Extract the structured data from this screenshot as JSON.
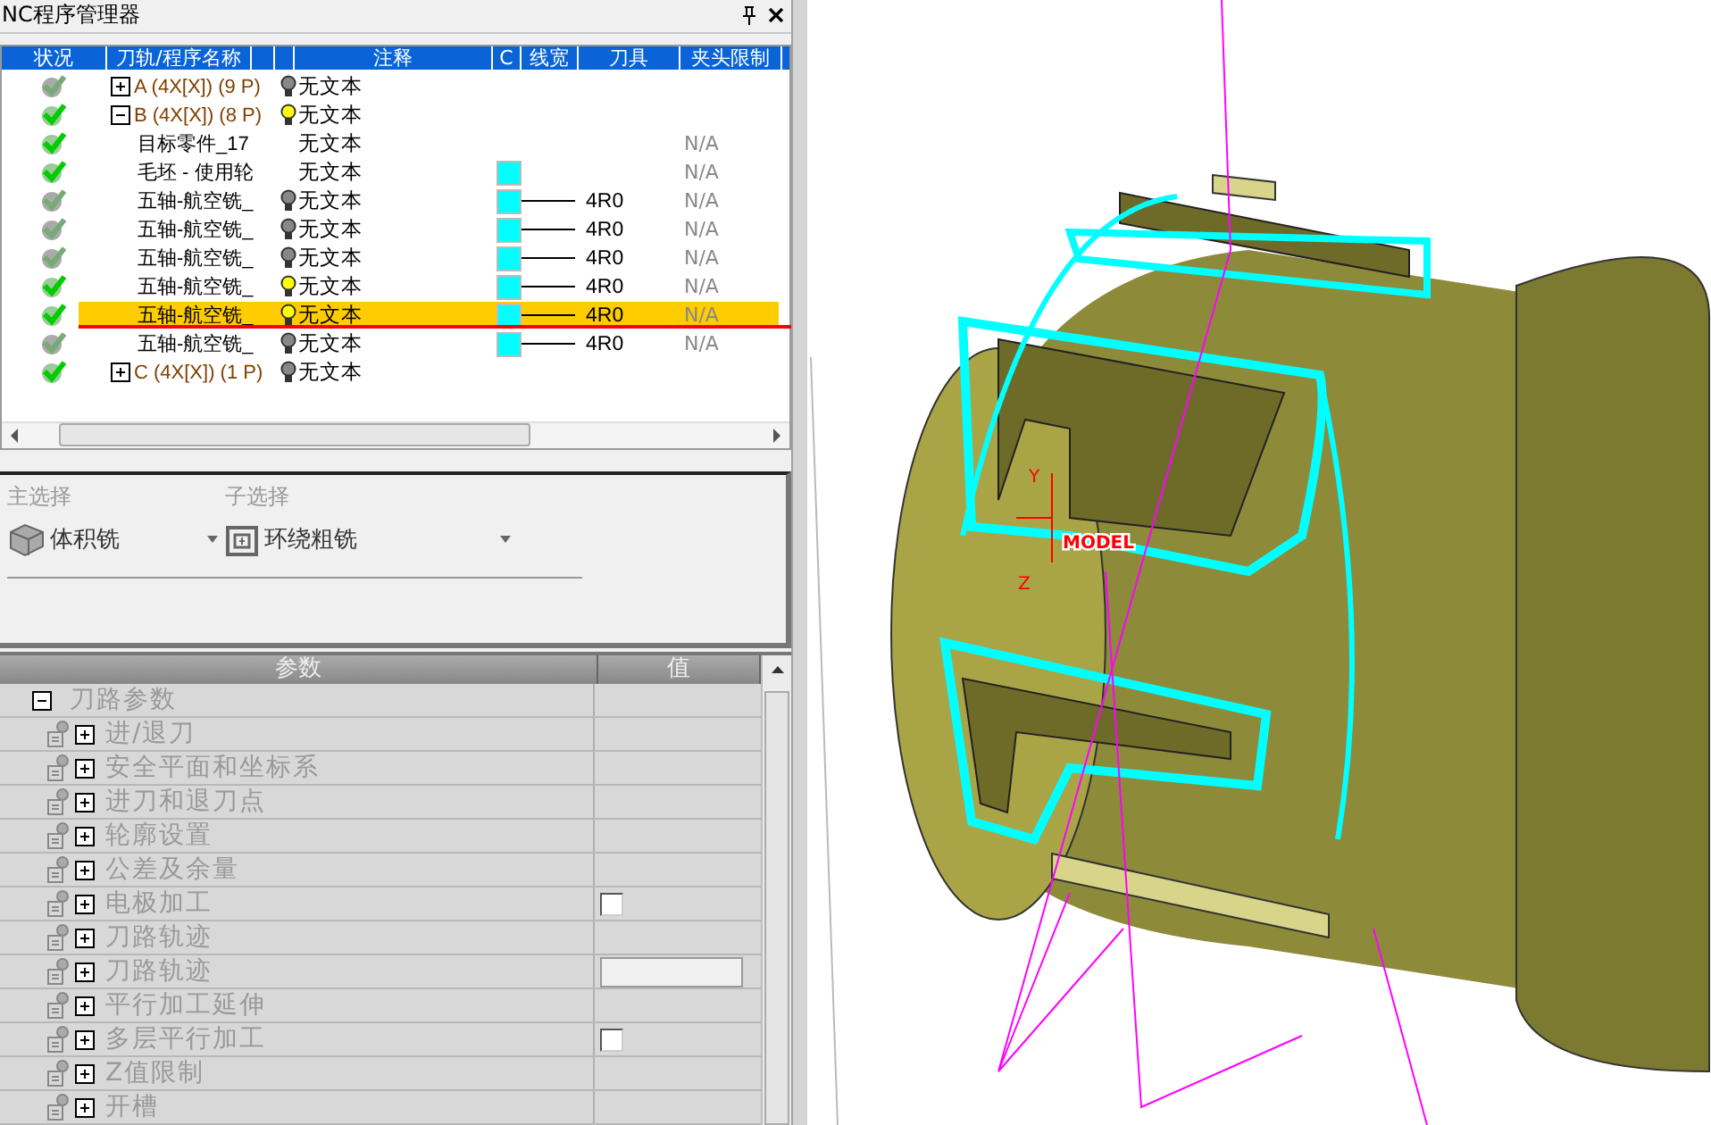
{
  "panel": {
    "title": "NC程序管理器"
  },
  "tree": {
    "columns": [
      "状况",
      "刀轨/程序名称",
      "",
      "",
      "注释",
      "C",
      "线宽",
      "刀具",
      "夹头限制"
    ],
    "rows": [
      {
        "complete": false,
        "expanded": false,
        "name": "A (4X[X]) (9 P)",
        "kind": "program",
        "lit": false,
        "note": "无文本",
        "selected": false
      },
      {
        "complete": true,
        "expanded": true,
        "name": "B (4X[X]) (8 P)",
        "kind": "program",
        "lit": true,
        "note": "无文本",
        "selected": false
      },
      {
        "complete": true,
        "name": "目标零件_17",
        "kind": "item",
        "note": "无文本",
        "clamp": "N/A",
        "selected": false
      },
      {
        "complete": true,
        "name": "毛坯 - 使用轮",
        "kind": "item",
        "note": "无文本",
        "swatch": true,
        "clamp": "N/A",
        "selected": false
      },
      {
        "complete": false,
        "name": "五轴-航空铣_",
        "kind": "item",
        "lit": false,
        "note": "无文本",
        "swatch": true,
        "tool": "4R0",
        "clamp": "N/A",
        "selected": false
      },
      {
        "complete": false,
        "name": "五轴-航空铣_",
        "kind": "item",
        "lit": false,
        "note": "无文本",
        "swatch": true,
        "tool": "4R0",
        "clamp": "N/A",
        "selected": false
      },
      {
        "complete": false,
        "name": "五轴-航空铣_",
        "kind": "item",
        "lit": false,
        "note": "无文本",
        "swatch": true,
        "tool": "4R0",
        "clamp": "N/A",
        "selected": false
      },
      {
        "complete": true,
        "name": "五轴-航空铣_",
        "kind": "item",
        "lit": true,
        "note": "无文本",
        "swatch": true,
        "tool": "4R0",
        "clamp": "N/A",
        "selected": false
      },
      {
        "complete": true,
        "name": "五轴-航空铣_",
        "kind": "item",
        "lit": true,
        "note": "无文本",
        "swatch": true,
        "tool": "4R0",
        "clamp": "N/A",
        "selected": true
      },
      {
        "complete": false,
        "name": "五轴-航空铣_",
        "kind": "item",
        "lit": false,
        "note": "无文本",
        "swatch": true,
        "tool": "4R0",
        "clamp": "N/A",
        "selected": false
      },
      {
        "complete": true,
        "expanded": false,
        "name": "C (4X[X]) (1 P)",
        "kind": "program",
        "lit": false,
        "note": "无文本",
        "selected": false
      }
    ]
  },
  "selection": {
    "main_label": "主选择",
    "main_value": "体积铣",
    "sub_label": "子选择",
    "sub_value": "环绕粗铣"
  },
  "params": {
    "columns": [
      "参数",
      "值"
    ],
    "rows": [
      {
        "kind": "group",
        "label": "刀路参数"
      },
      {
        "kind": "item",
        "label": "进/退刀"
      },
      {
        "kind": "item",
        "label": "安全平面和坐标系"
      },
      {
        "kind": "item",
        "label": "进刀和退刀点"
      },
      {
        "kind": "item",
        "label": "轮廓设置"
      },
      {
        "kind": "item",
        "label": "公差及余量"
      },
      {
        "kind": "checkbox",
        "label": "电极加工",
        "checked": false
      },
      {
        "kind": "item",
        "label": "刀路轨迹"
      },
      {
        "kind": "button",
        "label": "刀路轨迹"
      },
      {
        "kind": "item",
        "label": "平行加工延伸"
      },
      {
        "kind": "checkbox",
        "label": "多层平行加工",
        "checked": false
      },
      {
        "kind": "item",
        "label": "Z值限制"
      },
      {
        "kind": "item",
        "label": "开槽"
      }
    ]
  },
  "viewport": {
    "labels": [
      "Y",
      "Z",
      "MODEL"
    ]
  }
}
